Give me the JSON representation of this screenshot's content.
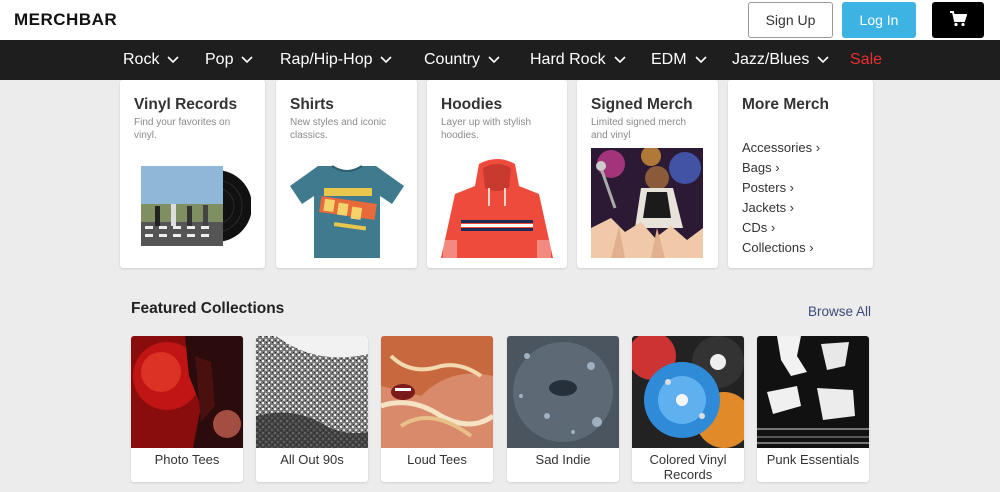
{
  "header": {
    "logo": "MERCHBAR",
    "signup_label": "Sign Up",
    "login_label": "Log In",
    "cart_icon": "cart-icon"
  },
  "nav": {
    "items": [
      {
        "label": "Rock"
      },
      {
        "label": "Pop"
      },
      {
        "label": "Rap/Hip-Hop"
      },
      {
        "label": "Country"
      },
      {
        "label": "Hard Rock"
      },
      {
        "label": "EDM"
      },
      {
        "label": "Jazz/Blues"
      }
    ],
    "sale_label": "Sale",
    "sale_color": "#e8312f"
  },
  "categories": [
    {
      "title": "Vinyl Records",
      "desc": "Find your favorites on vinyl."
    },
    {
      "title": "Shirts",
      "desc": "New styles and iconic classics."
    },
    {
      "title": "Hoodies",
      "desc": "Layer up with stylish hoodies."
    },
    {
      "title": "Signed Merch",
      "desc": "Limited signed merch and vinyl"
    }
  ],
  "more_merch": {
    "title": "More Merch",
    "links": [
      "Accessories ›",
      "Bags ›",
      "Posters ›",
      "Jackets ›",
      "CDs ›",
      "Collections ›"
    ]
  },
  "featured": {
    "title": "Featured Collections",
    "browse_all": "Browse All",
    "items": [
      {
        "label": "Photo Tees"
      },
      {
        "label": "All Out 90s"
      },
      {
        "label": "Loud Tees"
      },
      {
        "label": "Sad Indie"
      },
      {
        "label": "Colored Vinyl Records"
      },
      {
        "label": "Punk Essentials"
      }
    ]
  },
  "colors": {
    "accent": "#3db3e3",
    "nav_bg": "#1e1e1e",
    "page_bg": "#ececec"
  }
}
